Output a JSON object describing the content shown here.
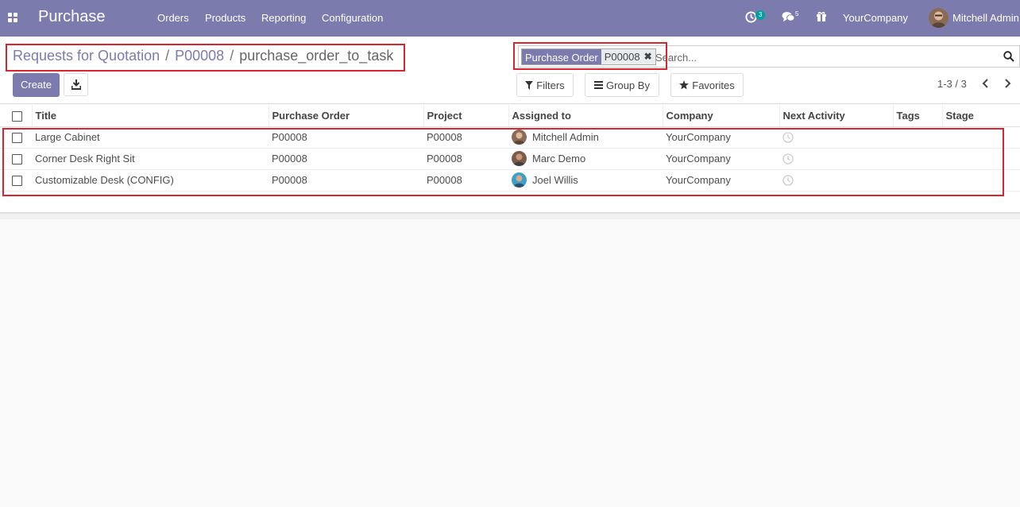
{
  "navbar": {
    "app_name": "Purchase",
    "menu": [
      "Orders",
      "Products",
      "Reporting",
      "Configuration"
    ],
    "activity_count": "3",
    "messages_count": "5",
    "company": "YourCompany",
    "user": "Mitchell Admin",
    "background": "#7c7bad"
  },
  "breadcrumb": {
    "items": [
      "Requests for Quotation",
      "P00008"
    ],
    "current": "purchase_order_to_task",
    "separator": "/"
  },
  "buttons": {
    "create": "Create"
  },
  "search": {
    "facet_label": "Purchase Order",
    "facet_value": "P00008",
    "placeholder": "Search..."
  },
  "filters": {
    "filters": "Filters",
    "group_by": "Group By",
    "favorites": "Favorites"
  },
  "pager": {
    "text": "1-3 / 3"
  },
  "table": {
    "headers": [
      "Title",
      "Purchase Order",
      "Project",
      "Assigned to",
      "Company",
      "Next Activity",
      "Tags",
      "Stage"
    ],
    "rows": [
      {
        "title": "Large Cabinet",
        "purchase_order": "P00008",
        "project": "P00008",
        "assigned_to": "Mitchell Admin",
        "company": "YourCompany",
        "tags": "",
        "stage": ""
      },
      {
        "title": "Corner Desk Right Sit",
        "purchase_order": "P00008",
        "project": "P00008",
        "assigned_to": "Marc Demo",
        "company": "YourCompany",
        "tags": "",
        "stage": ""
      },
      {
        "title": "Customizable Desk (CONFIG)",
        "purchase_order": "P00008",
        "project": "P00008",
        "assigned_to": "Joel Willis",
        "company": "YourCompany",
        "tags": "",
        "stage": ""
      }
    ]
  },
  "colors": {
    "accent": "#7c7bad",
    "highlight": "#d9252f",
    "badge": "#00a09d"
  }
}
